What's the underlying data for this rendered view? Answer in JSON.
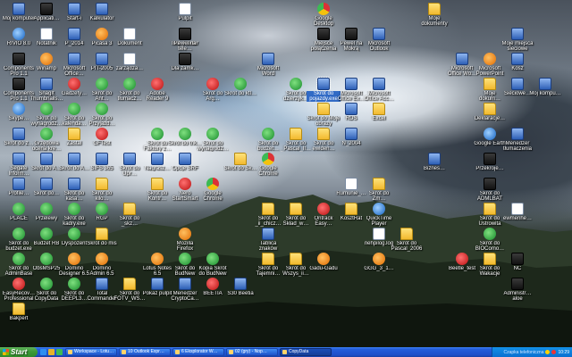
{
  "desktop": {
    "icons": [
      {
        "id": "mycomputer",
        "label": "Mój komputer",
        "glyph": "app"
      },
      {
        "id": "appl",
        "label": "Applicati…",
        "glyph": "dark"
      },
      {
        "id": "start-i",
        "label": "Start-i",
        "glyph": "app"
      },
      {
        "id": "kalkulator",
        "label": "Kalkulator",
        "glyph": "app"
      },
      {
        "id": "pulpit",
        "label": "Pulpit",
        "glyph": "doc"
      },
      {
        "id": "inst-faktur",
        "label": "Inst_Faktur",
        "glyph": "app"
      },
      {
        "id": "google-desktop",
        "label": "Google Desktop",
        "glyph": "chrome"
      },
      {
        "id": "miejsce-polaczenia",
        "label": "Miejsce połączenia",
        "glyph": "dark"
      },
      {
        "id": "moje-dokumenty",
        "label": "Moje dokumenty",
        "glyph": "folder"
      },
      {
        "id": "rivio",
        "label": "RIVIO 8.0",
        "glyph": "blue"
      },
      {
        "id": "notepad",
        "label": "Notatnik",
        "glyph": "doc"
      },
      {
        "id": "p2014",
        "label": "P_2014",
        "glyph": "app"
      },
      {
        "id": "picasa",
        "label": "Picasa 3",
        "glyph": "orange"
      },
      {
        "id": "dokument",
        "label": "Dokument",
        "glyph": "doc"
      },
      {
        "id": "pewel1",
        "label": "Pewel na tele…",
        "glyph": "dark"
      },
      {
        "id": "pewel2",
        "label": "Pewel na Mokrą",
        "glyph": "dark"
      },
      {
        "id": "ms-outlook",
        "label": "Microsoft Outlook",
        "glyph": "app"
      },
      {
        "id": "moje-miejsca",
        "label": "Moje miejsca sieciowe",
        "glyph": "app"
      },
      {
        "id": "componentes",
        "label": "Components Pro 1.1",
        "glyph": "dark"
      },
      {
        "id": "winamp",
        "label": "Winamp",
        "glyph": "orange"
      },
      {
        "id": "ms-office",
        "label": "Microsoft Office…",
        "glyph": "app"
      },
      {
        "id": "pit2005",
        "label": "PIT-2005",
        "glyph": "app"
      },
      {
        "id": "zarzadzanie",
        "label": "zarządza…",
        "glyph": "doc"
      },
      {
        "id": "dlazamkniecia",
        "label": "Dla zamk…",
        "glyph": "dark"
      },
      {
        "id": "ms-word",
        "label": "Microsoft Word",
        "glyph": "app"
      },
      {
        "id": "ms-office-w",
        "label": "Microsoft Office Wo…",
        "glyph": "app"
      },
      {
        "id": "ms-powerpoint",
        "label": "Microsoft PowerPoint",
        "glyph": "orange"
      },
      {
        "id": "kosz",
        "label": "Kosz",
        "glyph": "app"
      },
      {
        "id": "componentes2",
        "label": "Components Pro 1.1",
        "glyph": "dark"
      },
      {
        "id": "snagit",
        "label": "SnagIt Thumbnails…",
        "glyph": "app"
      },
      {
        "id": "gadgets",
        "label": "Gadżety…",
        "glyph": "red"
      },
      {
        "id": "skrot-ant",
        "label": "Skrót do Ant…",
        "glyph": "green"
      },
      {
        "id": "skrot-tlum",
        "label": "Skrót do tłumacz…",
        "glyph": "green"
      },
      {
        "id": "adobe-reader",
        "label": "Adobe Reader 9",
        "glyph": "red"
      },
      {
        "id": "skrot-arg",
        "label": "Skrót do Arg…",
        "glyph": "red"
      },
      {
        "id": "skrot-ktl",
        "label": "Skrót do ktl…",
        "glyph": "green"
      },
      {
        "id": "skrot-dzie",
        "label": "Skrót do dzierżyk…",
        "glyph": "green"
      },
      {
        "id": "skrot-pojazdy",
        "label": "Skrót do pojazdy.exe",
        "glyph": "app",
        "selected": true
      },
      {
        "id": "ms-office-e",
        "label": "Microsoft Office Ex…",
        "glyph": "app"
      },
      {
        "id": "ms-office-a",
        "label": "Microsoft Office Acc…",
        "glyph": "app"
      },
      {
        "id": "moje-dok2",
        "label": "Moje dokum…",
        "glyph": "folder"
      },
      {
        "id": "sieciowe",
        "label": "Sieciowe…",
        "glyph": "app"
      },
      {
        "id": "moj-komputer2",
        "label": "Mój kompu…",
        "glyph": "app"
      },
      {
        "id": "skype",
        "label": "Skype…",
        "glyph": "blue"
      },
      {
        "id": "skrot-wyn",
        "label": "Skrót do wynagrodz…",
        "glyph": "green"
      },
      {
        "id": "skrot-kal",
        "label": "Skrót do kalenda…",
        "glyph": "green"
      },
      {
        "id": "skrot-prz",
        "label": "Skrót do Przyjazd…",
        "glyph": "green"
      },
      {
        "id": "skrot-moje-obrazy",
        "label": "Skrót do Moje obrazy",
        "glyph": "folder"
      },
      {
        "id": "rds",
        "label": "RDS",
        "glyph": "app"
      },
      {
        "id": "excel",
        "label": "Excel",
        "glyph": "folder"
      },
      {
        "id": "deklaracje",
        "label": "Deklaracje…",
        "glyph": "folder"
      },
      {
        "id": "skrot-z",
        "label": "Skrót do z…",
        "glyph": "app"
      },
      {
        "id": "gs-ocena",
        "label": "Grzędowa ocena kre…",
        "glyph": "green"
      },
      {
        "id": "zastal",
        "label": "Zastal",
        "glyph": "folder"
      },
      {
        "id": "gg-test",
        "label": "GFTest",
        "glyph": "red"
      },
      {
        "id": "skrot-fakt",
        "label": "Skrót do Faktury z…",
        "glyph": "green"
      },
      {
        "id": "skrot-tnk",
        "label": "Skrót do tnk…",
        "glyph": "green"
      },
      {
        "id": "skrot-wyn2",
        "label": "Skrót do wynagrodz…",
        "glyph": "green"
      },
      {
        "id": "skrot-bud",
        "label": "Skrót do budżet…",
        "glyph": "green"
      },
      {
        "id": "skrot-pascal",
        "label": "Skrót do _Pascal_II…",
        "glyph": "folder"
      },
      {
        "id": "skrot-ewiden",
        "label": "Skrót do ewiden…",
        "glyph": "folder"
      },
      {
        "id": "n2004",
        "label": "N_2004",
        "glyph": "app"
      },
      {
        "id": "google-earth",
        "label": "Google Earth",
        "glyph": "blue"
      },
      {
        "id": "menedzer",
        "label": "Menedżer tłumaczenia",
        "glyph": "app"
      },
      {
        "id": "segate",
        "label": "Segate Inform…",
        "glyph": "app"
      },
      {
        "id": "skrot-a1",
        "label": "Skrót do A…",
        "glyph": "app"
      },
      {
        "id": "skrot-a2",
        "label": "Skrót do A…",
        "glyph": "app"
      },
      {
        "id": "sifs",
        "label": "SIFS 365",
        "glyph": "app"
      },
      {
        "id": "skrot-upr",
        "label": "Skrót do Upr…",
        "glyph": "app"
      },
      {
        "id": "nagrasz",
        "label": "Nagrasz…",
        "glyph": "app"
      },
      {
        "id": "opcje-srf",
        "label": "Opcje SRF",
        "glyph": "app"
      },
      {
        "id": "skrot-sk",
        "label": "Skrót do Sk…",
        "glyph": "folder"
      },
      {
        "id": "google-chrome",
        "label": "Google Chrome",
        "glyph": "chrome"
      },
      {
        "id": "biznes",
        "label": "Biznes…",
        "glyph": "app"
      },
      {
        "id": "przekroj",
        "label": "Przekroje…",
        "glyph": "dark"
      },
      {
        "id": "profile",
        "label": "Profile…",
        "glyph": "app"
      },
      {
        "id": "skrot-sk2",
        "label": "Skrót do…",
        "glyph": "app"
      },
      {
        "id": "skrot-kasa",
        "label": "Skrót do kasa…",
        "glyph": "app"
      },
      {
        "id": "skrot-kilo",
        "label": "Skrót do kilo…",
        "glyph": "folder"
      },
      {
        "id": "skrot-ks",
        "label": "Skrót do Kontr…",
        "glyph": "folder"
      },
      {
        "id": "nero",
        "label": "Nero StartSmart",
        "glyph": "red"
      },
      {
        "id": "chrome2",
        "label": "Google Chrome",
        "glyph": "chrome"
      },
      {
        "id": "rumunie",
        "label": "Rumunie_…",
        "glyph": "doc"
      },
      {
        "id": "skrot-zm",
        "label": "Skrót do Zm…",
        "glyph": "folder"
      },
      {
        "id": "skrot-admin",
        "label": "Skrót do ADMLBAT",
        "glyph": "dark"
      },
      {
        "id": "places",
        "label": "PLACE",
        "glyph": "green"
      },
      {
        "id": "przelewy",
        "label": "Przelewy",
        "glyph": "green"
      },
      {
        "id": "skrot-kadry",
        "label": "Skrót do kadry.exe",
        "glyph": "green"
      },
      {
        "id": "rgp",
        "label": "RGP",
        "glyph": "green"
      },
      {
        "id": "skrot-skz",
        "label": "Skrót do _skz…",
        "glyph": "folder"
      },
      {
        "id": "skrot-chicz",
        "label": "Skrót do _ii_chicz…",
        "glyph": "folder"
      },
      {
        "id": "skrot-sklad",
        "label": "Skrót do Skład_w…",
        "glyph": "folder"
      },
      {
        "id": "ontrack",
        "label": "Ontrack Easy…",
        "glyph": "red"
      },
      {
        "id": "kosztrat",
        "label": "KosztRat",
        "glyph": "folder"
      },
      {
        "id": "quicktime",
        "label": "QuickTime Player",
        "glyph": "blue"
      },
      {
        "id": "skrot-ustrew",
        "label": "Skrót do Ustrowita",
        "glyph": "folder"
      },
      {
        "id": "ewmenhe",
        "label": "ewmenhe…",
        "glyph": "doc"
      },
      {
        "id": "skrot-budzet",
        "label": "Skrót do budzet.exe",
        "glyph": "green"
      },
      {
        "id": "budzet-rb",
        "label": "Budżet RB",
        "glyph": "green"
      },
      {
        "id": "dyspozent",
        "label": "Dyspozent",
        "glyph": "green"
      },
      {
        "id": "skrot-mis",
        "label": "Skrót do mis",
        "glyph": "folder"
      },
      {
        "id": "mozilla",
        "label": "Mozilla Firefox",
        "glyph": "orange"
      },
      {
        "id": "tablica",
        "label": "Tablica znaków",
        "glyph": "app"
      },
      {
        "id": "nehpilog",
        "label": "nehpilog.log",
        "glyph": "doc"
      },
      {
        "id": "skrot-pascal2",
        "label": "Skrót do Pascal_2006",
        "glyph": "folder"
      },
      {
        "id": "skrot-ibio",
        "label": "Skrót do BIOComo…",
        "glyph": "green"
      },
      {
        "id": "skrot-adminb",
        "label": "Skrót do AdminBase",
        "glyph": "green"
      },
      {
        "id": "obsm",
        "label": "ObsMSP25",
        "glyph": "green"
      },
      {
        "id": "domino",
        "label": "Domino Designer 6.5",
        "glyph": "orange"
      },
      {
        "id": "domino-admin",
        "label": "Domino Admin 6.5",
        "glyph": "orange"
      },
      {
        "id": "lotus-notes",
        "label": "Lotus Notes 6.5",
        "glyph": "orange"
      },
      {
        "id": "skrot-budnew",
        "label": "Skrót do BudNew",
        "glyph": "green"
      },
      {
        "id": "kopia-skrot",
        "label": "Kopia Skrót do BudNew",
        "glyph": "green"
      },
      {
        "id": "skrot-tajemn",
        "label": "Skrót do Tajemni…",
        "glyph": "folder"
      },
      {
        "id": "skrot-wszys",
        "label": "Skrót do Wszys_ii…",
        "glyph": "folder"
      },
      {
        "id": "gadu",
        "label": "Gadu-Gadu",
        "glyph": "orange"
      },
      {
        "id": "ggg",
        "label": "GGG_3_1…",
        "glyph": "orange"
      },
      {
        "id": "beetle",
        "label": "Beetle_test",
        "glyph": "red"
      },
      {
        "id": "skrot-waka",
        "label": "Skrót do Wakacje",
        "glyph": "folder"
      },
      {
        "id": "nc",
        "label": "NC",
        "glyph": "dark"
      },
      {
        "id": "easyrecovery",
        "label": "EasyRecov… Professional",
        "glyph": "red"
      },
      {
        "id": "skrot-copy",
        "label": "Skrót do CopyData",
        "glyph": "green"
      },
      {
        "id": "skrot-deepl",
        "label": "Skrót do DEEPL3…",
        "glyph": "green"
      },
      {
        "id": "total",
        "label": "Total Commander",
        "glyph": "app"
      },
      {
        "id": "skrot-fotv",
        "label": "Skrót do FOTV_WS…",
        "glyph": "folder"
      },
      {
        "id": "pokaz-pulpit",
        "label": "Pokaż pulpit",
        "glyph": "app"
      },
      {
        "id": "menedzer-crypt",
        "label": "Menedżer CryptoCa…",
        "glyph": "app"
      },
      {
        "id": "beetia",
        "label": "BEETIA",
        "glyph": "red"
      },
      {
        "id": "s30",
        "label": "S30 Beetia",
        "glyph": "app"
      },
      {
        "id": "administ",
        "label": "Administr… aloe",
        "glyph": "dark"
      },
      {
        "id": "bakpert",
        "label": "Bakpert",
        "glyph": "folder"
      }
    ]
  },
  "taskbar": {
    "start_label": "Start",
    "tasks": [
      {
        "label": "Workspace - Lotu…",
        "active": false
      },
      {
        "label": "10 Outlook Expr…",
        "active": false
      },
      {
        "label": "6 Eksplorator W…",
        "active": false
      },
      {
        "label": "02 (gry) - Nop…",
        "active": false
      },
      {
        "label": "CopyData",
        "active": true
      }
    ],
    "tray": {
      "lang": "Czapka telefoniczna",
      "time": "10:29"
    }
  }
}
